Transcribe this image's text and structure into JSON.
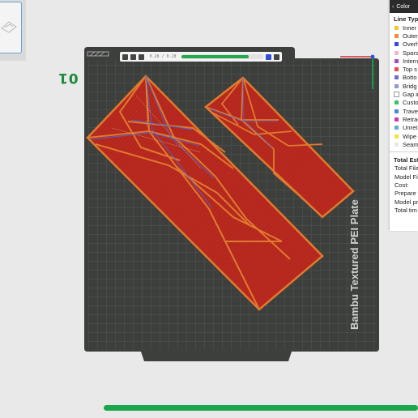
{
  "plate": {
    "number_label": "01",
    "name": "Bambu Textured PEI Plate"
  },
  "toolbar": {
    "layer_readout": "0.28 / 0.28"
  },
  "legend": {
    "header_title": "Color",
    "line_types_title": "Line Type",
    "items": [
      {
        "label": "Inner",
        "color": "#f5c43a"
      },
      {
        "label": "Outer",
        "color": "#f08c3c"
      },
      {
        "label": "Overh",
        "color": "#2e4fd6"
      },
      {
        "label": "Spars",
        "color": "#f2b8c8"
      },
      {
        "label": "Intern",
        "color": "#a34ec7"
      },
      {
        "label": "Top s",
        "color": "#e94a4a"
      },
      {
        "label": "Botto",
        "color": "#6d6dd0"
      },
      {
        "label": "Bridg",
        "color": "#8d9ad8"
      },
      {
        "label": "Gap in",
        "color": "#ffffff"
      },
      {
        "label": "Custo",
        "color": "#3dbf6a"
      },
      {
        "label": "Travel",
        "color": "#4a8ad4"
      },
      {
        "label": "Retrac",
        "color": "#c93ab0"
      },
      {
        "label": "Unret",
        "color": "#5fb0c8"
      },
      {
        "label": "Wipe",
        "color": "#f2e63a"
      },
      {
        "label": "Seams",
        "color": "#e8e8e8"
      }
    ],
    "estimate_title": "Total Est",
    "estimates": [
      "Total Fila",
      "Model Fil",
      "Cost:",
      "Prepare t",
      "Model pr",
      "Total tim"
    ]
  },
  "progress": {
    "percent": 100
  },
  "colors": {
    "plate": "#3d3f3d",
    "grid": "#5a5c5a",
    "print_fill": "#b8291f",
    "print_outline": "#e07a2e",
    "accent_green": "#1aa64a"
  }
}
